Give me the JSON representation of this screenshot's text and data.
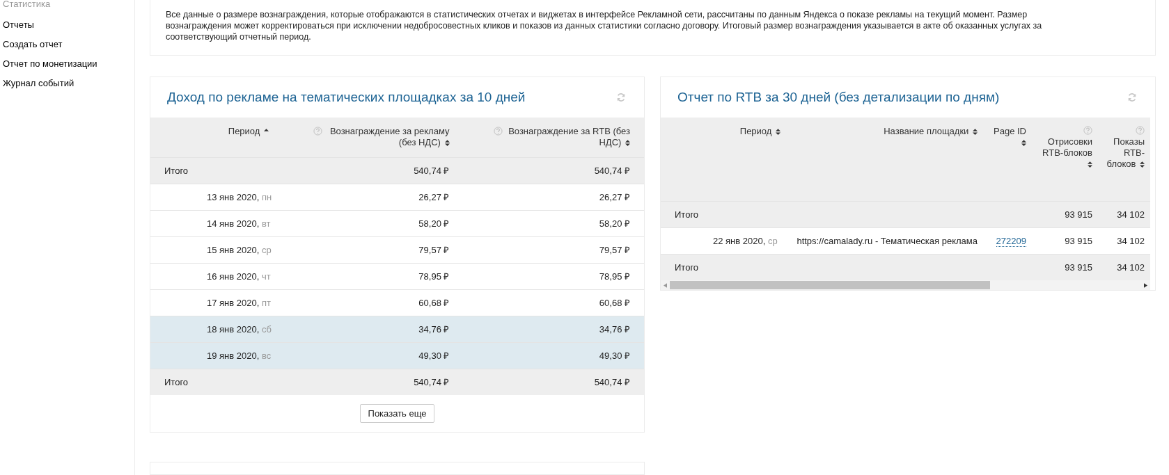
{
  "sidebar": {
    "items": [
      {
        "label": "Статистика",
        "kind": "heading"
      },
      {
        "label": "Отчеты",
        "kind": "link"
      },
      {
        "label": "Создать отчет",
        "kind": "link"
      },
      {
        "label": "Отчет по монетизации",
        "kind": "link"
      },
      {
        "label": "Журнал событий",
        "kind": "link"
      }
    ]
  },
  "notice": "Все данные о размере вознаграждения, которые отображаются в статистических отчетах и виджетах в интерфейсе Рекламной сети, рассчитаны по данным Яндекса о показе рекламы на текущий момент. Размер вознаграждения может корректироваться при исключении недобросовестных кликов и показов из данных статистики согласно договору. Итоговый размер вознаграждения указывается в акте об оказанных услугах за соответствующий отчетный период.",
  "income_widget": {
    "title": "Доход по рекламе на тематических площадках за 10 дней",
    "columns": [
      {
        "label": "Период",
        "sorted": true,
        "help": false
      },
      {
        "label": "Вознаграждение за рекламу (без НДС)",
        "sorted": false,
        "help": true
      },
      {
        "label": "Вознаграждение за RTB (без НДС)",
        "sorted": false,
        "help": true
      }
    ],
    "rows": [
      {
        "kind": "total",
        "label": "Итого",
        "values": [
          "540,74 ₽",
          "540,74 ₽"
        ],
        "weekend": false
      },
      {
        "kind": "day",
        "label": "13 янв 2020,",
        "weekday": "пн",
        "values": [
          "26,27 ₽",
          "26,27 ₽"
        ],
        "weekend": false
      },
      {
        "kind": "day",
        "label": "14 янв 2020,",
        "weekday": "вт",
        "values": [
          "58,20 ₽",
          "58,20 ₽"
        ],
        "weekend": false
      },
      {
        "kind": "day",
        "label": "15 янв 2020,",
        "weekday": "ср",
        "values": [
          "79,57 ₽",
          "79,57 ₽"
        ],
        "weekend": false
      },
      {
        "kind": "day",
        "label": "16 янв 2020,",
        "weekday": "чт",
        "values": [
          "78,95 ₽",
          "78,95 ₽"
        ],
        "weekend": false
      },
      {
        "kind": "day",
        "label": "17 янв 2020,",
        "weekday": "пт",
        "values": [
          "60,68 ₽",
          "60,68 ₽"
        ],
        "weekend": false
      },
      {
        "kind": "day",
        "label": "18 янв 2020,",
        "weekday": "сб",
        "values": [
          "34,76 ₽",
          "34,76 ₽"
        ],
        "weekend": true
      },
      {
        "kind": "day",
        "label": "19 янв 2020,",
        "weekday": "вс",
        "values": [
          "49,30 ₽",
          "49,30 ₽"
        ],
        "weekend": true
      },
      {
        "kind": "total",
        "label": "Итого",
        "values": [
          "540,74 ₽",
          "540,74 ₽"
        ],
        "weekend": false
      }
    ],
    "show_more": "Показать еще"
  },
  "rtb_widget": {
    "title": "Отчет по RTB за 30 дней (без детализации по дням)",
    "columns": [
      {
        "label": "Период",
        "sorted": false,
        "help": false
      },
      {
        "label": "Название площадки",
        "sorted": false,
        "help": false
      },
      {
        "label": "Page ID",
        "sorted": false,
        "help": false
      },
      {
        "label": "Отрисовки RTB-блоков",
        "sorted": false,
        "help": true
      },
      {
        "label": "Показы RTB-блоков",
        "sorted": false,
        "help": true
      }
    ],
    "rows": [
      {
        "kind": "total",
        "label": "Итого",
        "values": [
          "93 915",
          "34 102"
        ]
      },
      {
        "kind": "day",
        "label": "22 янв 2020,",
        "weekday": "ср",
        "site": "https://camalady.ru - Тематическая реклама",
        "page_id": "272209",
        "values": [
          "93 915",
          "34 102"
        ]
      },
      {
        "kind": "total",
        "label": "Итого",
        "values": [
          "93 915",
          "34 102"
        ]
      }
    ]
  }
}
